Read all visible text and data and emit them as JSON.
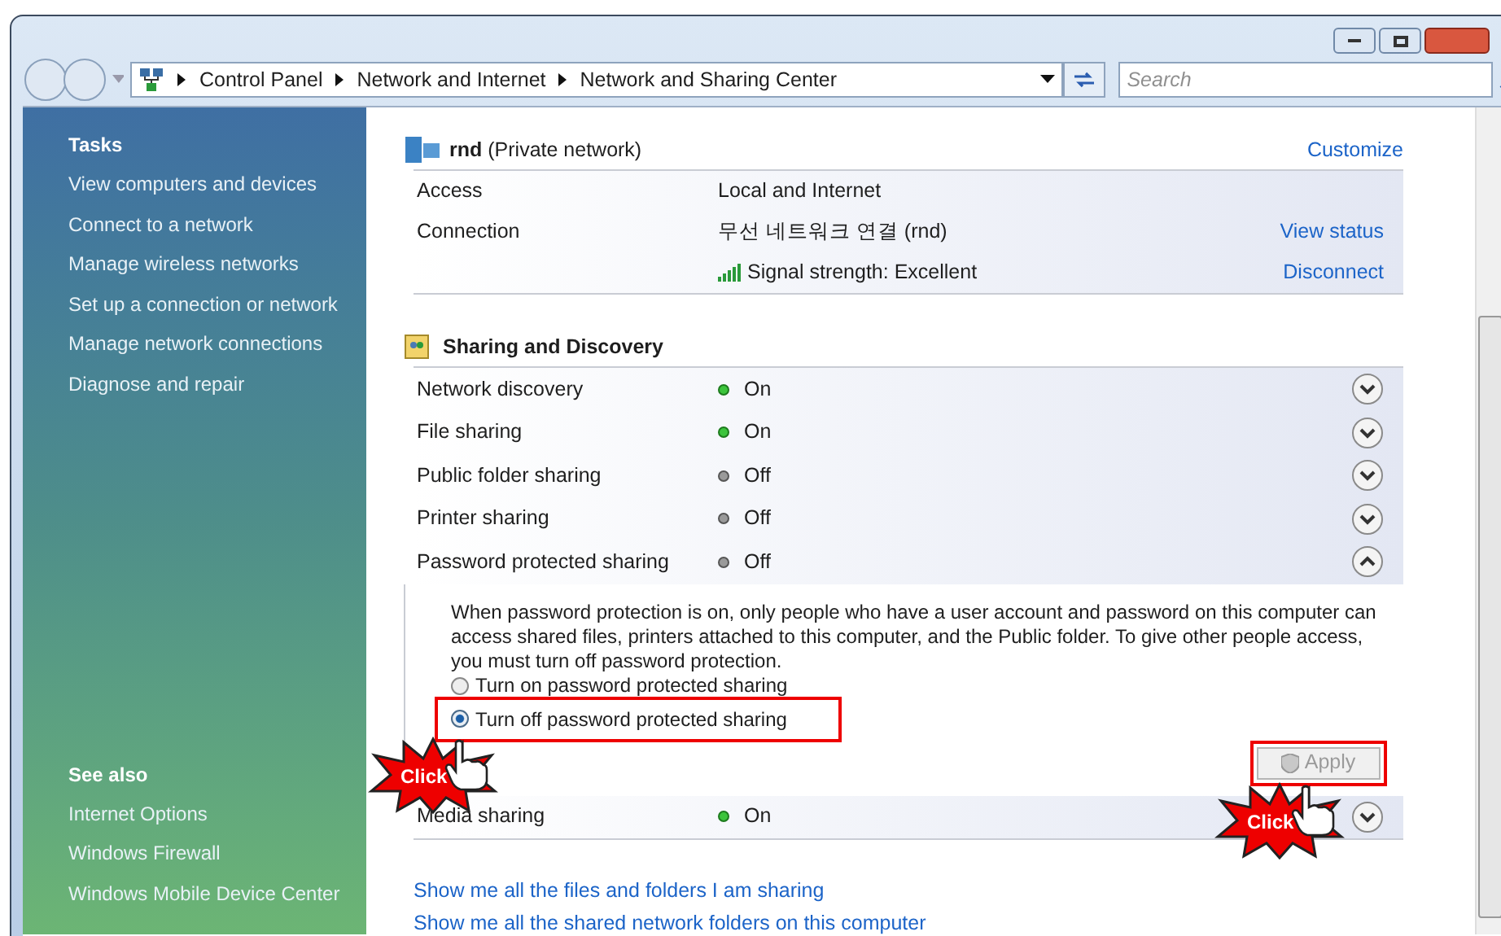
{
  "address_bar": {
    "crumbs": [
      "Control Panel",
      "Network and Internet",
      "Network and Sharing Center"
    ]
  },
  "search": {
    "placeholder": "Search"
  },
  "sidebar": {
    "tasks_title": "Tasks",
    "tasks": [
      "View computers and devices",
      "Connect to a network",
      "Manage wireless networks",
      "Set up a connection or network",
      "Manage network connections",
      "Diagnose and repair"
    ],
    "see_also_title": "See also",
    "see_also": [
      "Internet Options",
      "Windows Firewall",
      "Windows Mobile Device Center"
    ]
  },
  "network": {
    "name": "rnd",
    "type": "(Private network)",
    "customize": "Customize",
    "rows": [
      {
        "kind": "plain",
        "label": "Access",
        "value": "Local and Internet"
      },
      {
        "kind": "plain",
        "label": "Connection",
        "value": "무선 네트워크 연결 (rnd)",
        "link": "View status"
      },
      {
        "kind": "signal",
        "value": "Signal strength:  Excellent",
        "link": "Disconnect"
      }
    ]
  },
  "sharing": {
    "title": "Sharing and Discovery",
    "items": [
      {
        "label": "Network discovery",
        "status": "On",
        "on": true,
        "expanded": false
      },
      {
        "label": "File sharing",
        "status": "On",
        "on": true,
        "expanded": false
      },
      {
        "label": "Public folder sharing",
        "status": "Off",
        "on": false,
        "expanded": false
      },
      {
        "label": "Printer sharing",
        "status": "Off",
        "on": false,
        "expanded": false
      },
      {
        "label": "Password protected sharing",
        "status": "Off",
        "on": false,
        "expanded": true,
        "description": "When password protection is on, only people who have a user account and password on this computer can access shared files, printers attached to this computer, and the Public folder. To give other people access, you must turn off password protection.",
        "options": [
          {
            "label": "Turn on password protected sharing",
            "selected": false,
            "highlighted": false
          },
          {
            "label": "Turn off password protected sharing",
            "selected": true,
            "highlighted": true
          }
        ],
        "apply": {
          "label": "Apply",
          "disabled": true,
          "highlighted": true
        }
      },
      {
        "label": "Media sharing",
        "status": "On",
        "on": true,
        "expanded": false
      }
    ]
  },
  "links": [
    "Show me all the files and folders I am sharing",
    "Show me all the shared network folders on this computer"
  ],
  "annotations": [
    {
      "text": "Click"
    },
    {
      "text": "Click"
    }
  ]
}
